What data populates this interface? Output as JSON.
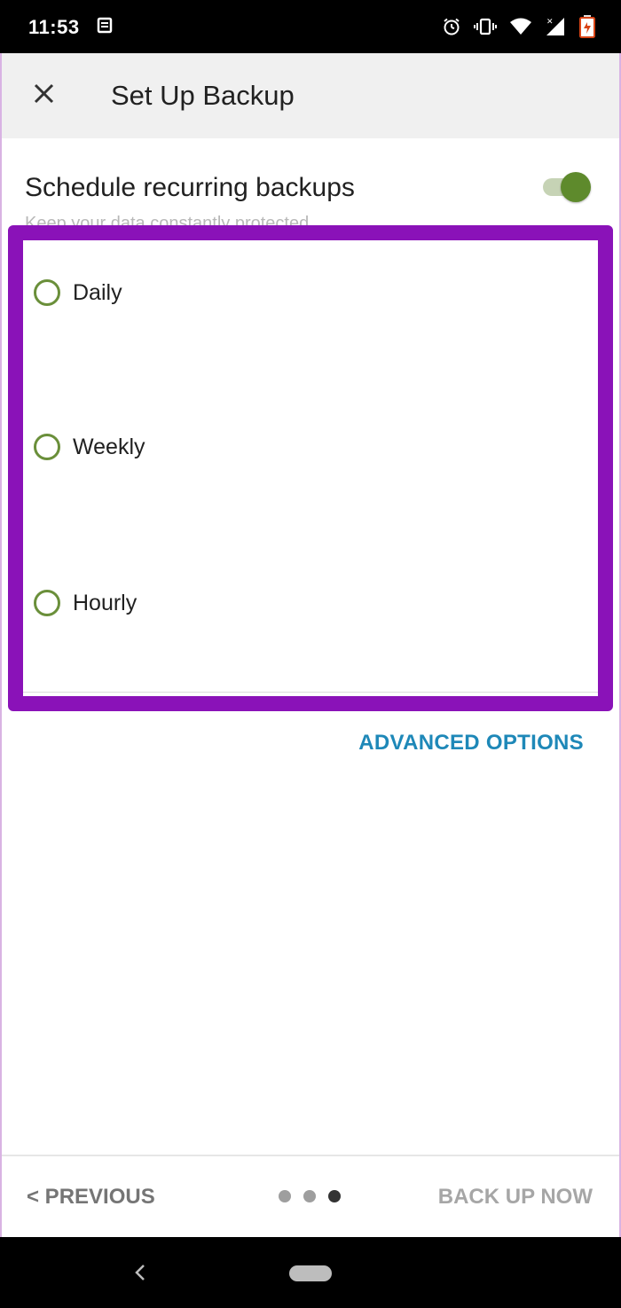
{
  "status_bar": {
    "time": "11:53",
    "icons": [
      "notification-icon",
      "alarm-icon",
      "vibrate-icon",
      "wifi-icon",
      "signal-icon",
      "battery-icon"
    ]
  },
  "app_bar": {
    "title": "Set Up Backup",
    "close_icon": "close-icon"
  },
  "schedule": {
    "title": "Schedule recurring backups",
    "subtitle": "Keep your data constantly protected",
    "toggle_on": true
  },
  "frequency": {
    "options": [
      {
        "label": "Daily",
        "selected": false
      },
      {
        "label": "Weekly",
        "selected": false
      },
      {
        "label": "Hourly",
        "selected": false
      }
    ]
  },
  "advanced_label": "ADVANCED OPTIONS",
  "footer": {
    "previous_label": "< PREVIOUS",
    "back_up_now_label": "BACK UP NOW",
    "page_count": 3,
    "current_page": 3
  },
  "colors": {
    "highlight": "#8a12b8",
    "accent_green": "#5e8a2c",
    "link_blue": "#1e88b8"
  }
}
